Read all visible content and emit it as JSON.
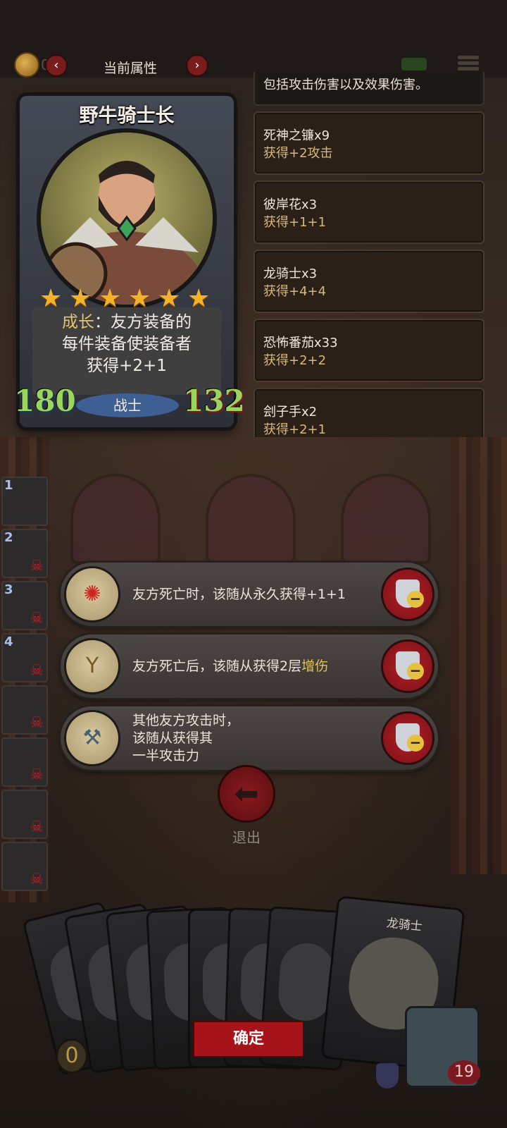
{
  "topbar": {
    "coin_value": "020",
    "tab_title": "当前属性",
    "prev_arrow": "‹",
    "next_arrow": "›"
  },
  "hero": {
    "name": "野牛骑士长",
    "stars": 6,
    "ability_label": "成长",
    "ability_line1": "：友方装备的",
    "ability_line2": "每件装备使装备者",
    "ability_line3": "获得+2+1",
    "attack": "180",
    "health": "132",
    "class": "战士"
  },
  "effects": {
    "top_text": "包括攻击伤害以及效果伤害。",
    "items": [
      {
        "name": "死神之镰x9",
        "gain": "获得+2攻击"
      },
      {
        "name": "彼岸花x3",
        "gain": "获得+1+1"
      },
      {
        "name": "龙骑士x3",
        "gain": "获得+4+4"
      },
      {
        "name": "恐怖番茄x33",
        "gain": "获得+2+2"
      },
      {
        "name": "刽子手x2",
        "gain": "获得+2+1"
      }
    ]
  },
  "roster": [
    "1",
    "2",
    "3",
    "4",
    "",
    "",
    "",
    ""
  ],
  "relics": [
    {
      "icon": "red-spider-lily-icon",
      "text_a": "友方死亡时，该随从永久获得+1+1",
      "text_hl": ""
    },
    {
      "icon": "slingshot-icon",
      "text_a": "友方死亡后，该随从获得2层",
      "text_hl": "增伤"
    },
    {
      "icon": "lightning-axe-icon",
      "line1": "其他友方攻击时，",
      "line2": "该随从获得其",
      "line3": "一半攻击力"
    }
  ],
  "exit_label": "退出",
  "hand": {
    "featured_card_name": "龙骑士",
    "confirm_label": "确定",
    "gold": "0",
    "lives": "19"
  },
  "colors": {
    "accent_red": "#a6141a",
    "star_gold": "#f3b229",
    "stat_green": "#9ad65d",
    "highlight_yellow": "#e3c15b"
  }
}
